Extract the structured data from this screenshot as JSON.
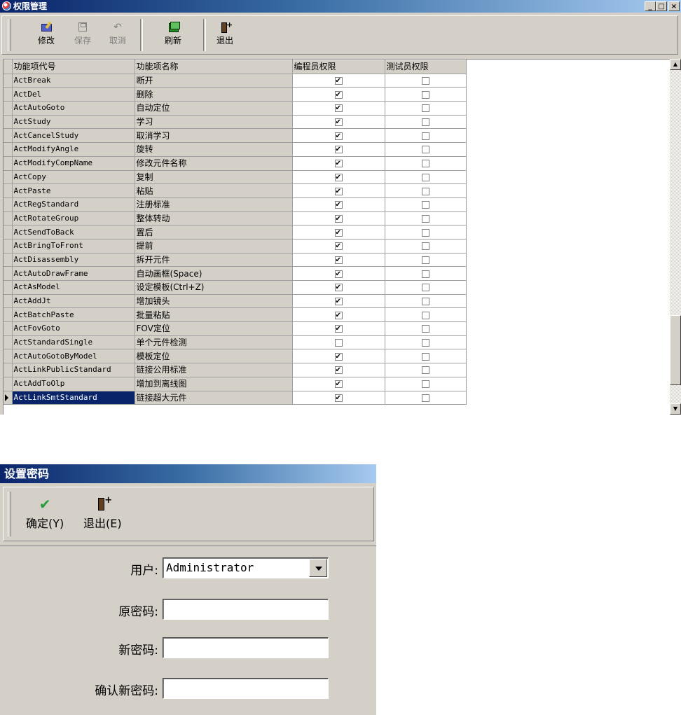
{
  "window1": {
    "title": "权限管理",
    "toolbar": {
      "edit_label": "修改",
      "save_label": "保存",
      "cancel_label": "取消",
      "refresh_label": "刷新",
      "exit_label": "退出"
    },
    "columns": [
      "功能项代号",
      "功能项名称",
      "编程员权限",
      "测试员权限"
    ],
    "rows": [
      {
        "code": "ActBreak",
        "name": "断开",
        "programmer": true,
        "tester": false
      },
      {
        "code": "ActDel",
        "name": "删除",
        "programmer": true,
        "tester": false
      },
      {
        "code": "ActAutoGoto",
        "name": "自动定位",
        "programmer": true,
        "tester": false
      },
      {
        "code": "ActStudy",
        "name": "学习",
        "programmer": true,
        "tester": false
      },
      {
        "code": "ActCancelStudy",
        "name": "取消学习",
        "programmer": true,
        "tester": false
      },
      {
        "code": "ActModifyAngle",
        "name": "旋转",
        "programmer": true,
        "tester": false
      },
      {
        "code": "ActModifyCompName",
        "name": "修改元件名称",
        "programmer": true,
        "tester": false
      },
      {
        "code": "ActCopy",
        "name": "复制",
        "programmer": true,
        "tester": false
      },
      {
        "code": "ActPaste",
        "name": "粘贴",
        "programmer": true,
        "tester": false
      },
      {
        "code": "ActRegStandard",
        "name": "注册标准",
        "programmer": true,
        "tester": false
      },
      {
        "code": "ActRotateGroup",
        "name": "整体转动",
        "programmer": true,
        "tester": false
      },
      {
        "code": "ActSendToBack",
        "name": "置后",
        "programmer": true,
        "tester": false
      },
      {
        "code": "ActBringToFront",
        "name": "提前",
        "programmer": true,
        "tester": false
      },
      {
        "code": "ActDisassembly",
        "name": "拆开元件",
        "programmer": true,
        "tester": false
      },
      {
        "code": "ActAutoDrawFrame",
        "name": "自动画框(Space)",
        "programmer": true,
        "tester": false
      },
      {
        "code": "ActAsModel",
        "name": "设定模板(Ctrl+Z)",
        "programmer": true,
        "tester": false
      },
      {
        "code": "ActAddJt",
        "name": "增加镜头",
        "programmer": true,
        "tester": false
      },
      {
        "code": "ActBatchPaste",
        "name": "批量粘贴",
        "programmer": true,
        "tester": false
      },
      {
        "code": "ActFovGoto",
        "name": "FOV定位",
        "programmer": true,
        "tester": false
      },
      {
        "code": "ActStandardSingle",
        "name": "单个元件检测",
        "programmer": false,
        "tester": false
      },
      {
        "code": "ActAutoGotoByModel",
        "name": "模板定位",
        "programmer": true,
        "tester": false
      },
      {
        "code": "ActLinkPublicStandard",
        "name": "链接公用标准",
        "programmer": true,
        "tester": false
      },
      {
        "code": "ActAddToOlp",
        "name": "增加到离线图",
        "programmer": true,
        "tester": false
      },
      {
        "code": "ActLinkSmtStandard",
        "name": "链接超大元件",
        "programmer": true,
        "tester": false,
        "current": true
      }
    ],
    "scroll_position": 0.93
  },
  "window2": {
    "title": "设置密码",
    "toolbar": {
      "ok_label": "确定(Y)",
      "exit_label": "退出(E)"
    },
    "form": {
      "user_label": "用户:",
      "user_value": "Administrator",
      "old_password_label": "原密码:",
      "old_password_value": "",
      "new_password_label": "新密码:",
      "new_password_value": "",
      "confirm_password_label": "确认新密码:",
      "confirm_password_value": ""
    }
  }
}
